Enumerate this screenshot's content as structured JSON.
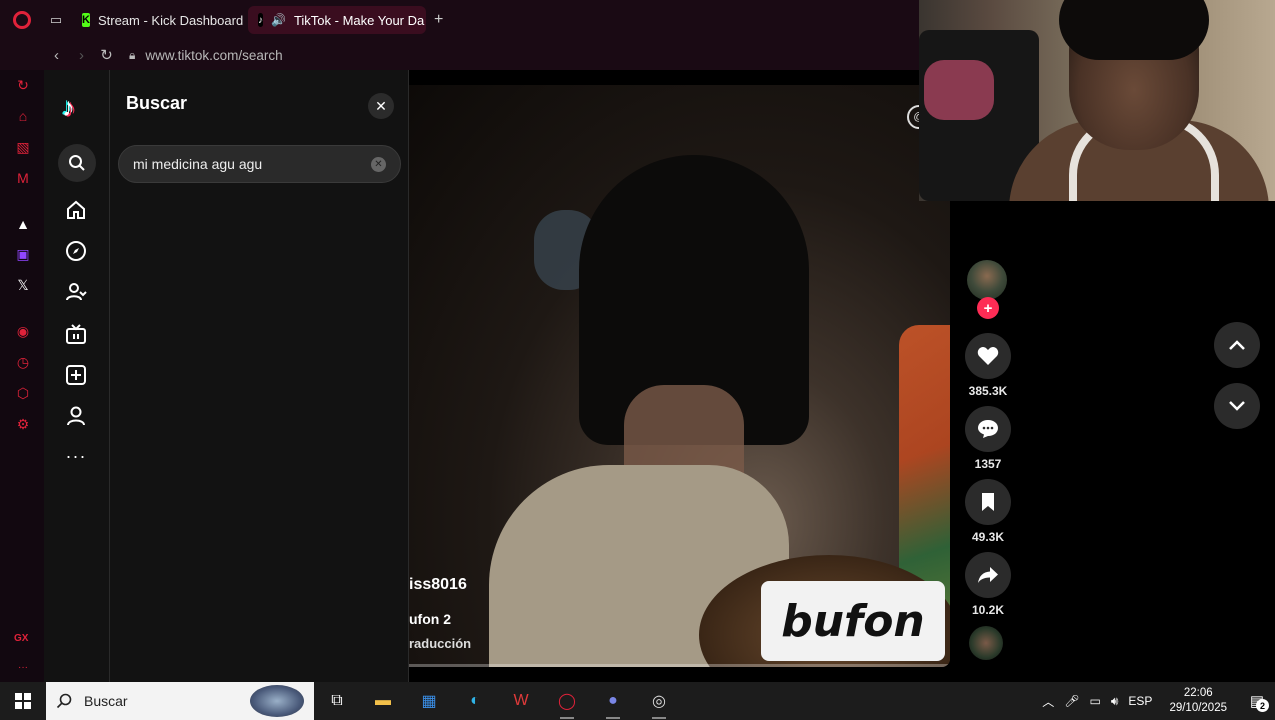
{
  "browser": {
    "tabs": [
      {
        "label": "Stream - Kick Dashboard",
        "icon": "kick-logo-icon",
        "active": false
      },
      {
        "label": "TikTok - Make Your Da",
        "icon": "tiktok-logo-icon",
        "active": true
      }
    ],
    "new_tab_label": "+",
    "url": "www.tiktok.com/search",
    "accent_color": "#e0223a"
  },
  "search_panel": {
    "title": "Buscar",
    "query": "mi medicina agu agu"
  },
  "video": {
    "username": "iss8016",
    "description": "ufon 2",
    "translation": "raducción",
    "sticker_text": "bufon",
    "progress_fraction": 0.0
  },
  "actions": {
    "likes": "385.3K",
    "comments": "1357",
    "saves": "49.3K",
    "shares": "10.2K"
  },
  "taskbar": {
    "search_placeholder": "Buscar",
    "language": "ESP",
    "time": "22:06",
    "date": "29/10/2025",
    "notification_count": "2"
  }
}
